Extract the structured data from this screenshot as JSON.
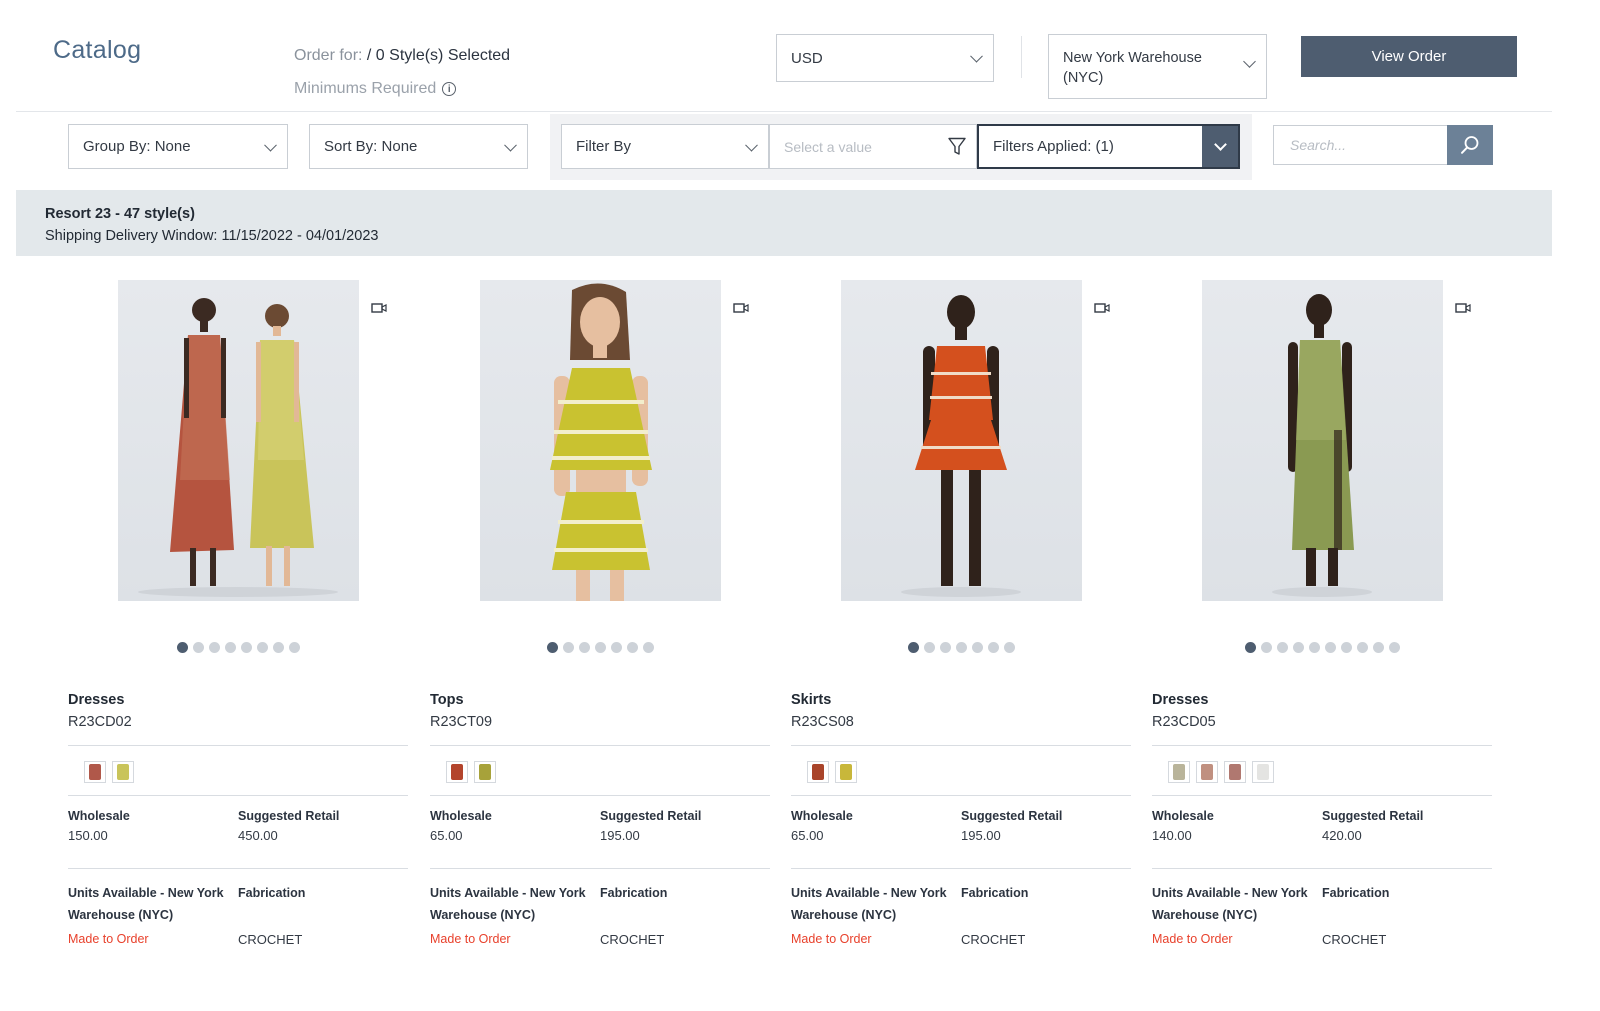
{
  "header": {
    "title": "Catalog",
    "order_for_label": "Order for: ",
    "order_for_value": "/ 0 Style(s) Selected",
    "minimums_label": "Minimums Required",
    "currency": "USD",
    "warehouse": "New York Warehouse (NYC)",
    "view_order_label": "View Order"
  },
  "toolbar": {
    "group_by": "Group By: None",
    "sort_by": "Sort By: None",
    "filter_by": "Filter By",
    "value_placeholder": "Select a value",
    "filters_applied": "Filters Applied: (1)",
    "search_placeholder": "Search..."
  },
  "season": {
    "title": "Resort 23 - 47 style(s)",
    "window": "Shipping Delivery Window: 11/15/2022 - 04/01/2023"
  },
  "labels": {
    "wholesale": "Wholesale",
    "suggested_retail": "Suggested Retail",
    "units_available": "Units Available - New York Warehouse (NYC)",
    "fabrication": "Fabrication"
  },
  "products": [
    {
      "category": "Dresses",
      "code": "R23CD02",
      "wholesale": "150.00",
      "retail": "450.00",
      "availability": "Made to Order",
      "fabrication": "CROCHET",
      "image_dots": 8,
      "active_dot": 0,
      "swatches": [
        "#b0584a",
        "#c9c45a"
      ]
    },
    {
      "category": "Tops",
      "code": "R23CT09",
      "wholesale": "65.00",
      "retail": "195.00",
      "availability": "Made to Order",
      "fabrication": "CROCHET",
      "image_dots": 7,
      "active_dot": 0,
      "swatches": [
        "#b3442c",
        "#a7a23a"
      ]
    },
    {
      "category": "Skirts",
      "code": "R23CS08",
      "wholesale": "65.00",
      "retail": "195.00",
      "availability": "Made to Order",
      "fabrication": "CROCHET",
      "image_dots": 7,
      "active_dot": 0,
      "swatches": [
        "#a9442a",
        "#c8b73a"
      ]
    },
    {
      "category": "Dresses",
      "code": "R23CD05",
      "wholesale": "140.00",
      "retail": "420.00",
      "availability": "Made to Order",
      "fabrication": "CROCHET",
      "image_dots": 10,
      "active_dot": 0,
      "swatches": [
        "#b9b49a",
        "#c09080",
        "#b07870",
        "#e4e4e2"
      ]
    }
  ],
  "colors": {
    "brand": "#4e5d70",
    "accent_title": "#4d6a88",
    "banner_bg": "#e3e8eb",
    "made_to_order": "#e8412c"
  },
  "icons": {
    "info": "info-circle-icon",
    "chevron": "chevron-down-icon",
    "filter": "funnel-icon",
    "search": "search-icon",
    "video": "video-camera-icon"
  }
}
